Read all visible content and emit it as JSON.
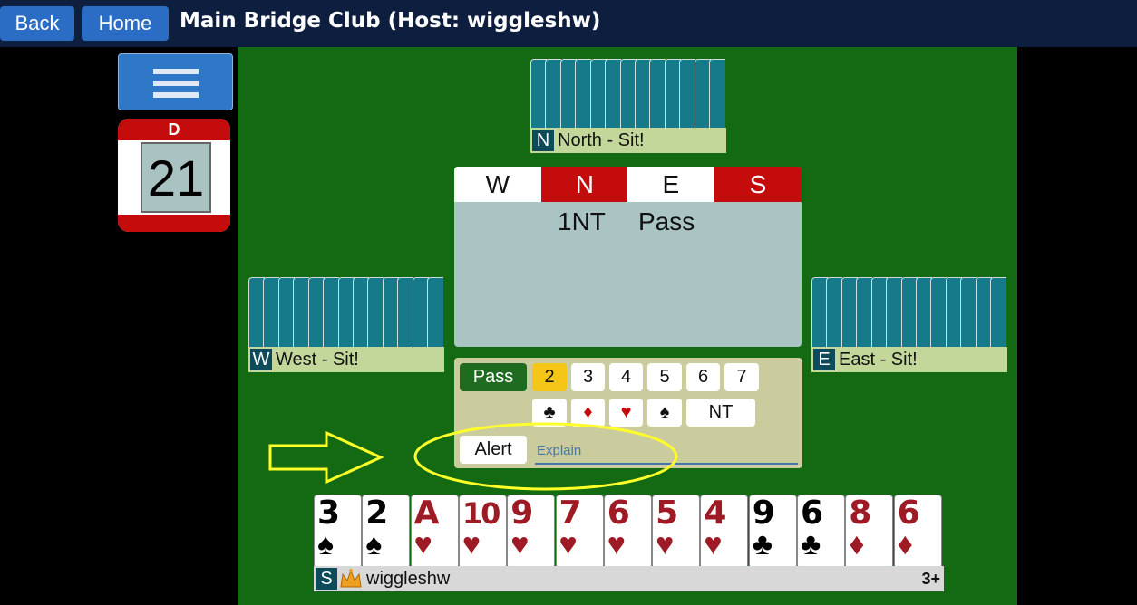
{
  "header": {
    "back_label": "Back",
    "home_label": "Home",
    "title": "Main Bridge Club (Host: wiggleshw)"
  },
  "board": {
    "dealer": "D",
    "number": "21"
  },
  "seats": {
    "north": {
      "letter": "N",
      "label": "North - Sit!"
    },
    "west": {
      "letter": "W",
      "label": "West - Sit!"
    },
    "east": {
      "letter": "E",
      "label": "East - Sit!"
    },
    "south": {
      "letter": "S",
      "player": "wiggleshw",
      "rating": "3+"
    }
  },
  "auction": {
    "headers": [
      "W",
      "N",
      "E",
      "S"
    ],
    "vulnerable": {
      "W": false,
      "N": true,
      "E": false,
      "S": true
    },
    "bids": [
      "",
      "1NT",
      "Pass",
      ""
    ]
  },
  "bidding_box": {
    "pass_label": "Pass",
    "levels": [
      "2",
      "3",
      "4",
      "5",
      "6",
      "7"
    ],
    "selected_level": "2",
    "strains": [
      "♣",
      "♦",
      "♥",
      "♠",
      "NT"
    ],
    "alert_label": "Alert",
    "explain_placeholder": "Explain"
  },
  "hand": [
    {
      "rank": "3",
      "suit": "♠",
      "color": "black"
    },
    {
      "rank": "2",
      "suit": "♠",
      "color": "black"
    },
    {
      "rank": "A",
      "suit": "♥",
      "color": "red"
    },
    {
      "rank": "10",
      "suit": "♥",
      "color": "red"
    },
    {
      "rank": "9",
      "suit": "♥",
      "color": "red"
    },
    {
      "rank": "7",
      "suit": "♥",
      "color": "red"
    },
    {
      "rank": "6",
      "suit": "♥",
      "color": "red"
    },
    {
      "rank": "5",
      "suit": "♥",
      "color": "red"
    },
    {
      "rank": "4",
      "suit": "♥",
      "color": "red"
    },
    {
      "rank": "9",
      "suit": "♣",
      "color": "black"
    },
    {
      "rank": "6",
      "suit": "♣",
      "color": "black"
    },
    {
      "rank": "8",
      "suit": "♦",
      "color": "red"
    },
    {
      "rank": "6",
      "suit": "♦",
      "color": "red"
    }
  ],
  "colors": {
    "felt": "#136a12",
    "vulnerable_red": "#c40c0c",
    "selected_level": "#f5c518",
    "card_red": "#9e1a24",
    "annotation_yellow": "#ffff2a"
  }
}
